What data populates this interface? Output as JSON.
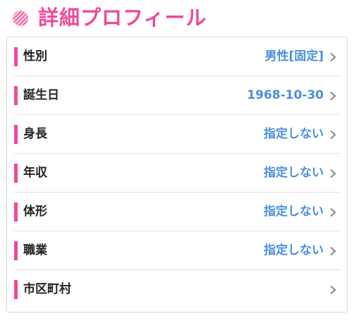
{
  "header": {
    "title": "詳細プロフィール",
    "icon": "striped-circle-icon"
  },
  "colors": {
    "accent": "#f0489a",
    "value": "#4a8fdc",
    "label": "#222222",
    "divider": "#e2e2e2"
  },
  "rows": [
    {
      "label": "性別",
      "value": "男性[固定]"
    },
    {
      "label": "誕生日",
      "value": "1968-10-30"
    },
    {
      "label": "身長",
      "value": "指定しない"
    },
    {
      "label": "年収",
      "value": "指定しない"
    },
    {
      "label": "体形",
      "value": "指定しない"
    },
    {
      "label": "職業",
      "value": "指定しない"
    },
    {
      "label": "市区町村",
      "value": ""
    }
  ]
}
